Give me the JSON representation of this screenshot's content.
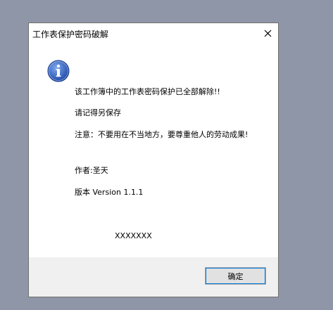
{
  "dialog": {
    "title": "工作表保护密码破解",
    "messages": {
      "line1": "该工作簿中的工作表密码保护已全部解除!!",
      "line2": "请记得另保存",
      "line3": "注意：不要用在不当地方，要尊重他人的劳动成果!",
      "author": "作者:圣天",
      "version": "版本 Version 1.1.1",
      "watermark": "XXXXXXX"
    },
    "ok_label": "确定",
    "icon": "info-icon",
    "close_icon": "close-icon"
  },
  "colors": {
    "desktop": "#8f96a8",
    "footer": "#f0f0f0",
    "focus": "#0078d7",
    "info_icon": "#2f5fbf"
  }
}
